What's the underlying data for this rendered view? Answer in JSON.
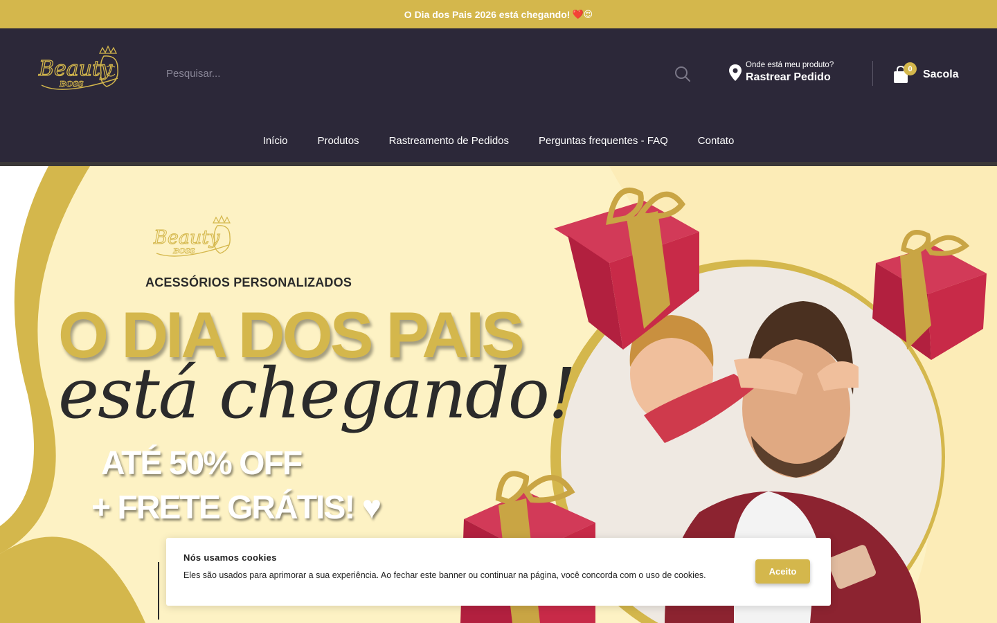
{
  "announcement": {
    "text": "O Dia dos Pais 2026 está chegando!",
    "emojis": "❤️😍"
  },
  "header": {
    "logo": {
      "line1": "Beauty",
      "line2": "BOSS"
    },
    "search": {
      "placeholder": "Pesquisar..."
    },
    "track": {
      "small": "Onde está meu produto?",
      "big": "Rastrear Pedido"
    },
    "bag": {
      "count": "0",
      "label": "Sacola"
    }
  },
  "nav": {
    "items": [
      {
        "label": "Início"
      },
      {
        "label": "Produtos"
      },
      {
        "label": "Rastreamento de Pedidos"
      },
      {
        "label": "Perguntas frequentes - FAQ"
      },
      {
        "label": "Contato"
      }
    ]
  },
  "hero": {
    "eyebrow": "ACESSÓRIOS PERSONALIZADOS",
    "title": "O DIA DOS PAIS",
    "script": "está chegando!",
    "discount": "ATÉ 50% OFF",
    "shipping": "+ FRETE GRÁTIS!",
    "heart": "♥"
  },
  "cookie": {
    "title": "Nós usamos cookies",
    "text": "Eles são usados para aprimorar a sua experiência. Ao fechar este banner ou continuar na página, você concorda com o uso de cookies.",
    "button": "Aceito"
  },
  "colors": {
    "gold": "#d4b74c",
    "header_bg": "#2c2839",
    "hero_bg": "#fdf2c4",
    "gift_red": "#c2224a"
  }
}
